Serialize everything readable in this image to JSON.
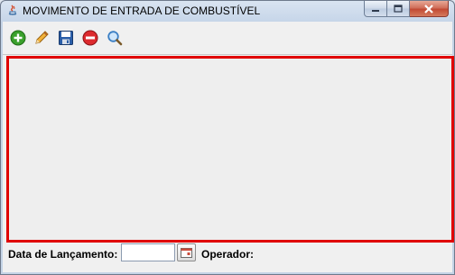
{
  "window": {
    "title": "MOVIMENTO DE ENTRADA DE COMBUSTÍVEL",
    "controls": [
      "minimize-icon",
      "maximize-icon",
      "close-icon"
    ]
  },
  "toolbar": {
    "buttons": [
      {
        "name": "add",
        "icon": "add-icon",
        "color": "#2f9e22"
      },
      {
        "name": "edit",
        "icon": "pencil-icon",
        "color": "#e89b1c"
      },
      {
        "name": "save",
        "icon": "floppy-disk-icon",
        "color": "#2b5ea8"
      },
      {
        "name": "delete",
        "icon": "delete-icon",
        "color": "#d8262b"
      },
      {
        "name": "search",
        "icon": "magnifier-icon",
        "color": "#3b7fc4"
      }
    ]
  },
  "panel": {
    "border_color": "#e00000"
  },
  "footer": {
    "date_label": "Data de Lançamento:",
    "date_value": "",
    "calendar_icon": "calendar-icon",
    "operator_label": "Operador:"
  }
}
